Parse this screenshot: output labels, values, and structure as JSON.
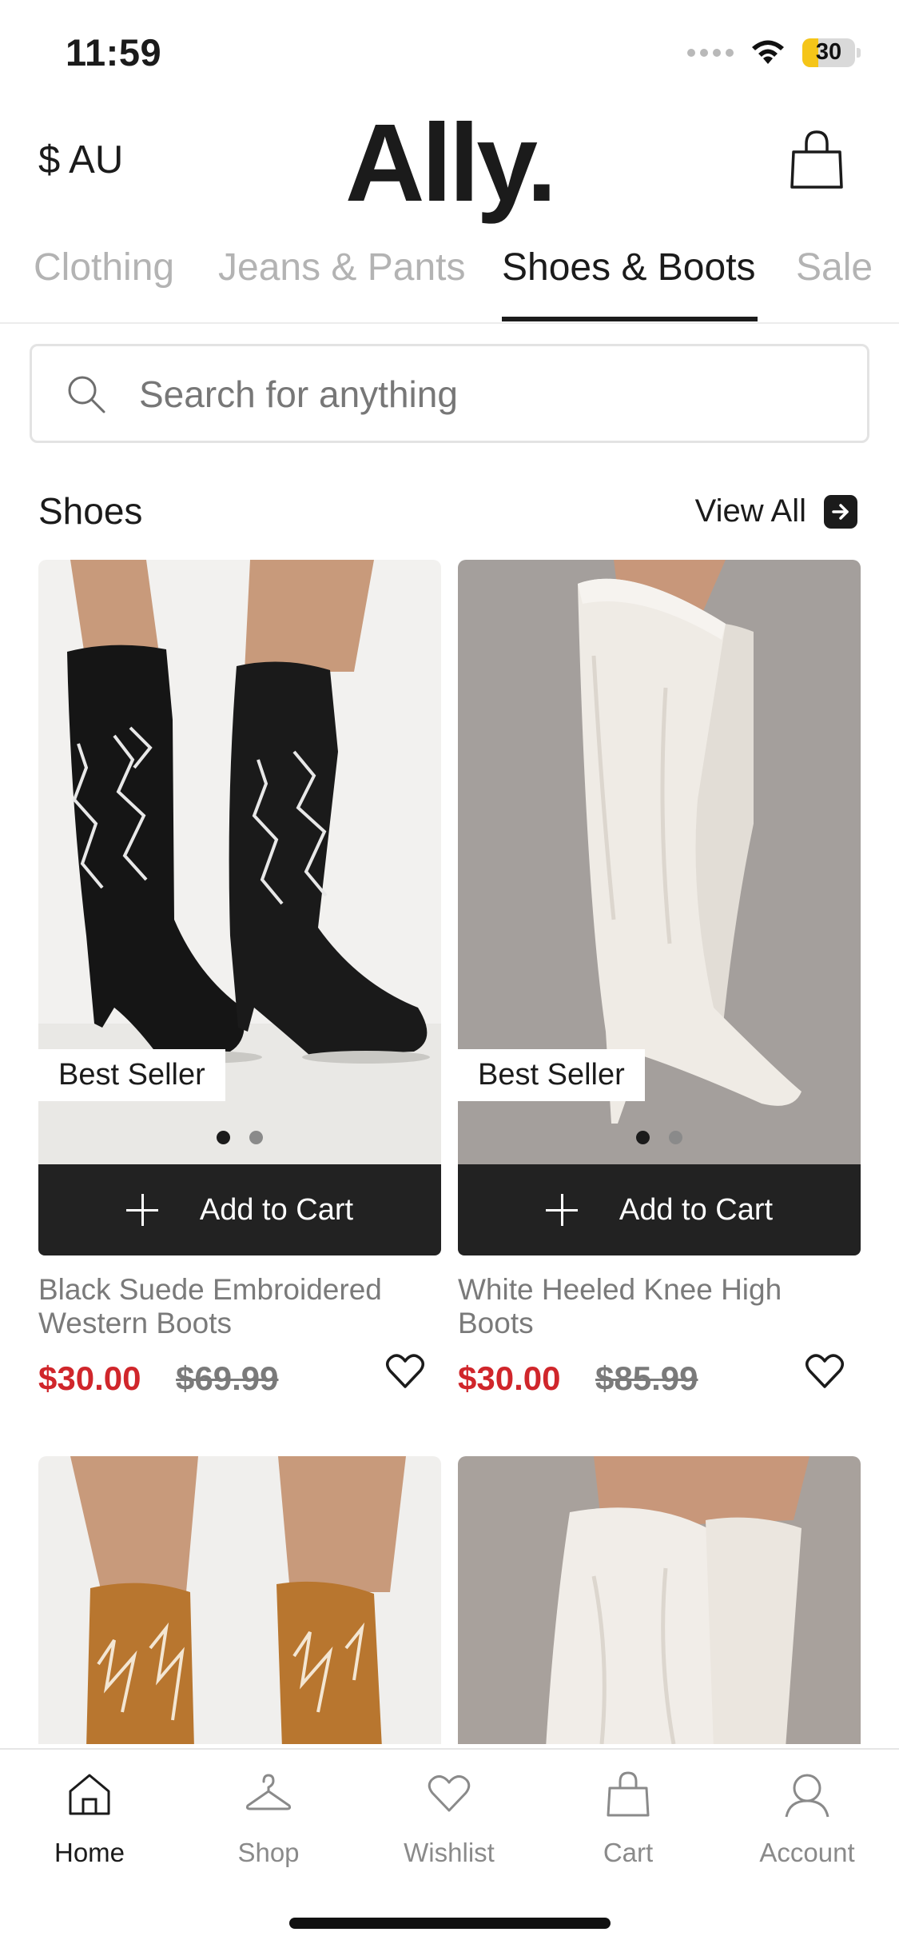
{
  "status_bar": {
    "time": "11:59",
    "battery": "30"
  },
  "header": {
    "currency": "$ AU",
    "logo": "Ally.",
    "bag_icon": "shopping-bag-icon"
  },
  "tabs": [
    {
      "label": "Clothing",
      "active": false
    },
    {
      "label": "Jeans & Pants",
      "active": false
    },
    {
      "label": "Shoes & Boots",
      "active": true
    },
    {
      "label": "Sale",
      "active": false
    }
  ],
  "search": {
    "placeholder": "Search for anything",
    "value": "",
    "icon": "search-icon"
  },
  "section": {
    "title": "Shoes",
    "view_all": "View All"
  },
  "products": [
    {
      "badge": "Best Seller",
      "add_to_cart": "Add to Cart",
      "name": "Black Suede Embroidered Western Boots",
      "sale_price": "$30.00",
      "original_price": "$69.99",
      "image_index": 1,
      "image_count": 2
    },
    {
      "badge": "Best Seller",
      "add_to_cart": "Add to Cart",
      "name": "White Heeled Knee High Boots",
      "sale_price": "$30.00",
      "original_price": "$85.99",
      "image_index": 1,
      "image_count": 2
    }
  ],
  "bottom_nav": [
    {
      "label": "Home",
      "icon": "home-icon",
      "active": true
    },
    {
      "label": "Shop",
      "icon": "hanger-icon",
      "active": false
    },
    {
      "label": "Wishlist",
      "icon": "heart-icon",
      "active": false
    },
    {
      "label": "Cart",
      "icon": "shopping-bag-icon",
      "active": false
    },
    {
      "label": "Account",
      "icon": "user-icon",
      "active": false
    }
  ],
  "colors": {
    "sale_price": "#d0262b",
    "button_bg": "#222222",
    "battery": "#f5c518"
  }
}
